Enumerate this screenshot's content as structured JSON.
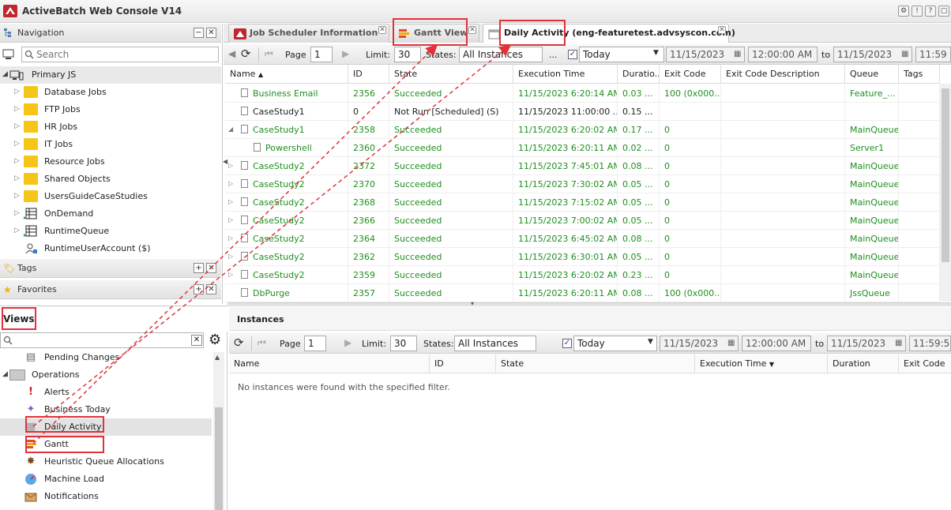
{
  "app": {
    "title": "ActiveBatch Web Console V14"
  },
  "navigation": {
    "title": "Navigation",
    "search_placeholder": "Search",
    "root": "Primary JS",
    "items": [
      {
        "label": "Database Jobs",
        "icon": "folder-icon"
      },
      {
        "label": "FTP Jobs",
        "icon": "folder-icon"
      },
      {
        "label": "HR Jobs",
        "icon": "folder-icon"
      },
      {
        "label": "IT Jobs",
        "icon": "folder-icon"
      },
      {
        "label": "Resource Jobs",
        "icon": "folder-icon"
      },
      {
        "label": "Shared Objects",
        "icon": "folder-icon"
      },
      {
        "label": "UsersGuideCaseStudies",
        "icon": "folder-icon"
      },
      {
        "label": "OnDemand",
        "icon": "queue-icon"
      },
      {
        "label": "RuntimeQueue",
        "icon": "queue-icon"
      },
      {
        "label": "RuntimeUserAccount ($)",
        "icon": "user-account-icon"
      }
    ],
    "tags_label": "Tags",
    "favorites_label": "Favorites"
  },
  "views": {
    "title": "Views",
    "items": [
      {
        "label": "Pending Changes",
        "icon": "pending-icon"
      },
      {
        "label": "Operations",
        "icon": "folder-icon"
      },
      {
        "label": "Alerts",
        "icon": "alert-icon"
      },
      {
        "label": "Business Today",
        "icon": "business-icon"
      },
      {
        "label": "Daily Activity",
        "icon": "daily-activity-icon"
      },
      {
        "label": "Gantt",
        "icon": "gantt-icon"
      },
      {
        "label": "Heuristic Queue Allocations",
        "icon": "heuristic-icon"
      },
      {
        "label": "Machine Load",
        "icon": "gauge-icon"
      },
      {
        "label": "Notifications",
        "icon": "notification-icon"
      }
    ]
  },
  "tabs": [
    {
      "label": "Job Scheduler Information"
    },
    {
      "label": "Gantt View"
    },
    {
      "label": "Daily Activity (eng-featuretest.advsyscon.com)"
    }
  ],
  "toolbar": {
    "page_label": "Page",
    "page_value": "1",
    "limit_label": "Limit:",
    "limit_value": "30",
    "states_label": "States:",
    "states_value": "All Instances",
    "ellipsis": "...",
    "range_value": "Today",
    "from_date": "11/15/2023",
    "from_time": "12:00:00 AM",
    "to_label": "to",
    "to_date": "11/15/2023",
    "to_time_top": "11:59",
    "to_time_bottom": "11:59:59"
  },
  "grid": {
    "columns": [
      "Name",
      "ID",
      "State",
      "Execution Time",
      "Duratio...",
      "Exit Code",
      "Exit Code Description",
      "Queue",
      "Tags"
    ],
    "rows": [
      {
        "name": "Business Email",
        "id": "2356",
        "state": "Succeeded",
        "exec": "11/15/2023 6:20:14 AM",
        "dur": "0.03 ...",
        "exit": "100 (0x000...",
        "queue": "Feature_...",
        "green": true,
        "arrow": "",
        "indent": 0
      },
      {
        "name": "CaseStudy1",
        "id": "0",
        "state": "Not Run [Scheduled] (S)",
        "exec": "11/15/2023 11:00:00 ...",
        "dur": "0.15 ...",
        "exit": "",
        "queue": "",
        "green": false,
        "arrow": "",
        "indent": 0
      },
      {
        "name": "CaseStudy1",
        "id": "2358",
        "state": "Succeeded",
        "exec": "11/15/2023 6:20:02 AM",
        "dur": "0.17 ...",
        "exit": "0",
        "queue": "MainQueue",
        "green": true,
        "arrow": "◢",
        "indent": 0
      },
      {
        "name": "Powershell",
        "id": "2360",
        "state": "Succeeded",
        "exec": "11/15/2023 6:20:11 AM",
        "dur": "0.02 ...",
        "exit": "0",
        "queue": "Server1",
        "green": true,
        "arrow": "",
        "indent": 1
      },
      {
        "name": "CaseStudy2",
        "id": "2372",
        "state": "Succeeded",
        "exec": "11/15/2023 7:45:01 AM",
        "dur": "0.08 ...",
        "exit": "0",
        "queue": "MainQueue",
        "green": true,
        "arrow": "▷",
        "indent": 0
      },
      {
        "name": "CaseStudy2",
        "id": "2370",
        "state": "Succeeded",
        "exec": "11/15/2023 7:30:02 AM",
        "dur": "0.05 ...",
        "exit": "0",
        "queue": "MainQueue",
        "green": true,
        "arrow": "▷",
        "indent": 0
      },
      {
        "name": "CaseStudy2",
        "id": "2368",
        "state": "Succeeded",
        "exec": "11/15/2023 7:15:02 AM",
        "dur": "0.05 ...",
        "exit": "0",
        "queue": "MainQueue",
        "green": true,
        "arrow": "▷",
        "indent": 0
      },
      {
        "name": "CaseStudy2",
        "id": "2366",
        "state": "Succeeded",
        "exec": "11/15/2023 7:00:02 AM",
        "dur": "0.05 ...",
        "exit": "0",
        "queue": "MainQueue",
        "green": true,
        "arrow": "▷",
        "indent": 0
      },
      {
        "name": "CaseStudy2",
        "id": "2364",
        "state": "Succeeded",
        "exec": "11/15/2023 6:45:02 AM",
        "dur": "0.08 ...",
        "exit": "0",
        "queue": "MainQueue",
        "green": true,
        "arrow": "▷",
        "indent": 0
      },
      {
        "name": "CaseStudy2",
        "id": "2362",
        "state": "Succeeded",
        "exec": "11/15/2023 6:30:01 AM",
        "dur": "0.05 ...",
        "exit": "0",
        "queue": "MainQueue",
        "green": true,
        "arrow": "▷",
        "indent": 0
      },
      {
        "name": "CaseStudy2",
        "id": "2359",
        "state": "Succeeded",
        "exec": "11/15/2023 6:20:02 AM",
        "dur": "0.23 ...",
        "exit": "0",
        "queue": "MainQueue",
        "green": true,
        "arrow": "▷",
        "indent": 0
      },
      {
        "name": "DbPurge",
        "id": "2357",
        "state": "Succeeded",
        "exec": "11/15/2023 6:20:11 AM",
        "dur": "0.08 ...",
        "exit": "100 (0x000...",
        "queue": "JssQueue",
        "green": true,
        "arrow": "",
        "indent": 0
      }
    ]
  },
  "instances": {
    "title": "Instances",
    "columns": [
      "Name",
      "ID",
      "State",
      "Execution Time",
      "Duration",
      "Exit Code"
    ],
    "empty_message": "No instances were found with the specified filter."
  },
  "colors": {
    "success": "#1e8f1e",
    "callout": "#e0323a",
    "folder": "#f5c518"
  }
}
